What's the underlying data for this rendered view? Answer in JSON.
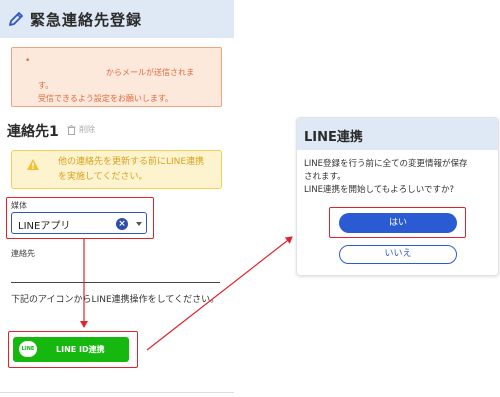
{
  "header": {
    "title": "緊急連絡先登録",
    "icon": "pencil-icon"
  },
  "notice": {
    "bullet": "•",
    "line1": "からメールが送信されま",
    "line2": "す。",
    "line3": "受信できるよう設定をお願いします。"
  },
  "contact": {
    "title": "連絡先1",
    "delete_label": "削除"
  },
  "warning": {
    "line1": "他の連絡先を更新する前にLINE連携",
    "line2": "を実施してください。"
  },
  "medium": {
    "label": "媒体",
    "value": "LINEアプリ",
    "clear_symbol": "×"
  },
  "contact_field": {
    "label": "連絡先",
    "value": ""
  },
  "instruction": "下記のアイコンからLINE連携操作をしてください。",
  "line_button": {
    "logo": "LINE",
    "label": "LINE ID連携"
  },
  "dialog": {
    "title": "LINE連携",
    "message_line1": "LINE登録を行う前に全ての変更情報が保存",
    "message_line2": "されます。",
    "message_line3": "LINE連携を開始してもよろしいですか?",
    "yes_label": "はい",
    "no_label": "いいえ"
  },
  "colors": {
    "header_bg": "#dfe9f6",
    "accent_blue": "#2b5bd3",
    "line_green": "#16b80f",
    "highlight_red": "#e0242c",
    "warning_yellow": "#fdf4cf",
    "notice_orange": "#fde8dc"
  }
}
